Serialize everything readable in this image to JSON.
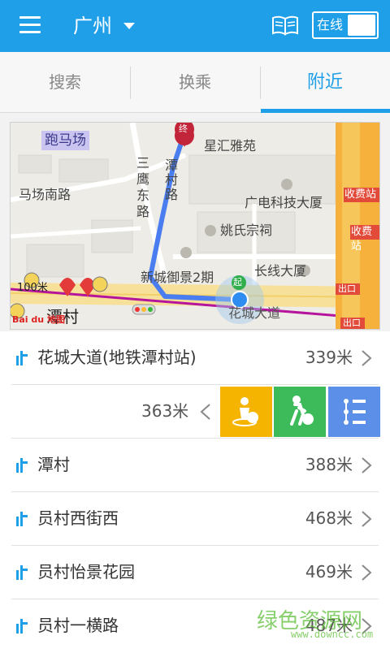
{
  "header": {
    "city": "广州",
    "online_label": "在线",
    "accent": "#1e9fe8"
  },
  "tabs": [
    {
      "label": "搜索",
      "active": false
    },
    {
      "label": "换乘",
      "active": false
    },
    {
      "label": "附近",
      "active": true
    }
  ],
  "map": {
    "labels": {
      "paomachang": "跑马场",
      "xinghuiyayuan": "星汇雅苑",
      "majiaonanlu": "马场南路",
      "tancunlu": "潭村路",
      "sanying": "三鹰东路",
      "guangdian": "广电科技大厦",
      "shoufeizhan1": "收费站",
      "shoufeizhan2": "收费站",
      "yaoshi": "姚氏宗祠",
      "xincheng": "新城御景2期",
      "changxian": "长线大厦",
      "huachengdadao": "花城大道",
      "tancun": "潭村",
      "chukou1": "出口",
      "chukou2": "出口",
      "scale": "100米",
      "end_marker": "终",
      "start_marker": "起",
      "logo": "Bai du 地图"
    },
    "route_color": "#4a7ef0"
  },
  "results": [
    {
      "name": "花城大道(地铁潭村站)",
      "distance": "339米"
    },
    {
      "name": "",
      "distance": "363米"
    },
    {
      "name": "潭村",
      "distance": "388米"
    },
    {
      "name": "员村西街西",
      "distance": "468米"
    },
    {
      "name": "员村怡景花园",
      "distance": "469米"
    },
    {
      "name": "员村一横路",
      "distance": "487米"
    }
  ],
  "actions": {
    "start_icon": "start-point-icon",
    "walk_icon": "walk-icon",
    "list_icon": "route-list-icon"
  },
  "watermark": {
    "text": "绿色资源网",
    "sub": "www.downcc.com"
  }
}
